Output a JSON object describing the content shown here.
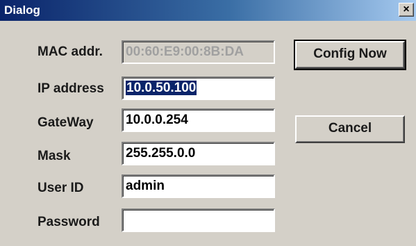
{
  "window": {
    "title": "Dialog",
    "close_glyph": "×"
  },
  "form": {
    "mac": {
      "label": "MAC addr.",
      "value": "00:60:E9:00:8B:DA"
    },
    "ip": {
      "label": "IP address",
      "value": "10.0.50.100"
    },
    "gateway": {
      "label": "GateWay",
      "value": "10.0.0.254"
    },
    "mask": {
      "label": "Mask",
      "value": "255.255.0.0"
    },
    "user_id": {
      "label": "User ID",
      "value": "admin"
    },
    "password": {
      "label": "Password",
      "value": ""
    }
  },
  "buttons": {
    "config_now": "Config Now",
    "cancel": "Cancel"
  },
  "colors": {
    "title_bar_start": "#0a246a",
    "title_bar_end": "#a6caf0",
    "dialog_face": "#d4d0c8",
    "selection": "#0a246a"
  },
  "icons": {
    "close": "close-icon"
  }
}
